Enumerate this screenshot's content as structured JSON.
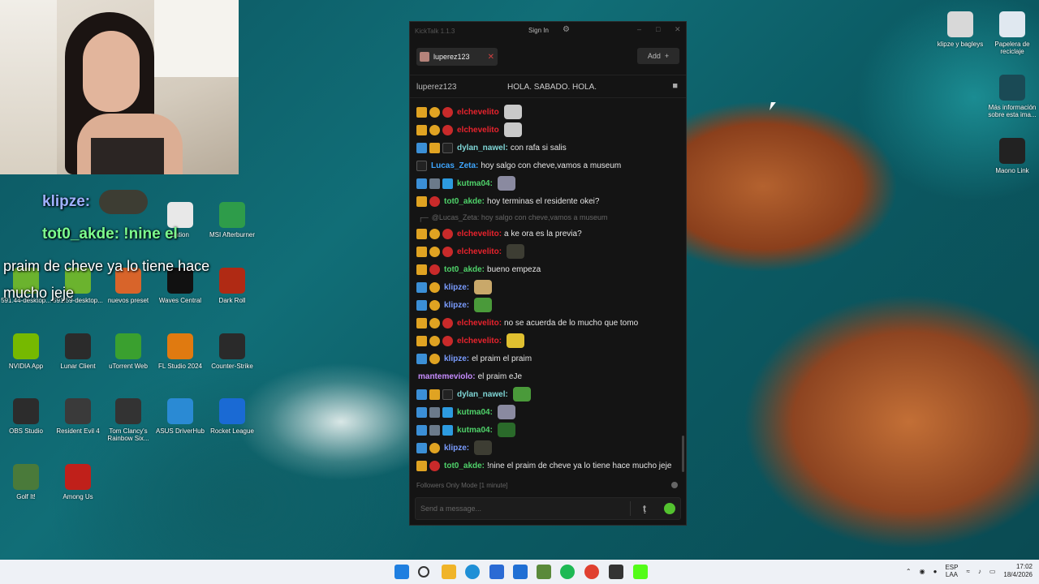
{
  "overlay": {
    "line1_user": "klipze:",
    "line2_user": "tot0_akde: !nine el",
    "message": "praim de cheve ya lo tiene hace mucho jeje"
  },
  "desktop_icons_left": [
    {
      "label": "dation",
      "color": "#e8e8e8"
    },
    {
      "label": "MSI Afterburner",
      "color": "#2e9c4a"
    },
    {
      "label": "591.44-desktop...",
      "color": "#6bb32e"
    },
    {
      "label": "591.59-desktop...",
      "color": "#6bb32e"
    },
    {
      "label": "nuevos preset",
      "color": "#d8642a"
    },
    {
      "label": "Waves Central",
      "color": "#111111"
    },
    {
      "label": "Dark Roll",
      "color": "#b02a14"
    },
    {
      "label": "NVIDIA App",
      "color": "#76b900"
    },
    {
      "label": "Lunar Client",
      "color": "#2b2b2b"
    },
    {
      "label": "uTorrent Web",
      "color": "#3aa02f"
    },
    {
      "label": "FL Studio 2024",
      "color": "#e07a10"
    },
    {
      "label": "Counter-Strike",
      "color": "#2a2a2a"
    },
    {
      "label": "OBS Studio",
      "color": "#2c2c2c"
    },
    {
      "label": "Resident Evil 4",
      "color": "#3a3a3a"
    },
    {
      "label": "Tom Clancy's Rainbow Six...",
      "color": "#333333"
    },
    {
      "label": "ASUS DriverHub",
      "color": "#2a8ad4"
    },
    {
      "label": "Rocket League",
      "color": "#1a6ad4"
    },
    {
      "label": "Golf It!",
      "color": "#4a7a3a"
    },
    {
      "label": "Among Us",
      "color": "#c0201a"
    }
  ],
  "desktop_icons_right": [
    {
      "label": "klipze y bagleys",
      "color": "#d8d8d8"
    },
    {
      "label": "Papelera de reciclaje",
      "color": "#e0e8f0"
    },
    {
      "label": "Más información sobre esta ima...",
      "color": "#1a4a55"
    },
    {
      "label": "Maono Link",
      "color": "#222222"
    }
  ],
  "kicktalk": {
    "title": "KickTalk 1.1.3",
    "sign_in": "Sign In",
    "tab_label": "luperez123",
    "add_label": "Add",
    "channel": "luperez123",
    "pinned": "HOLA. SABADO. HOLA.",
    "mode_text": "Followers Only Mode [1 minute]",
    "input_placeholder": "Send a message...",
    "messages": [
      {
        "badges": [
          "crown",
          "one",
          "red"
        ],
        "user": "elchevelito",
        "user_color": "#e8232d",
        "text": "",
        "emote": "#c9c9c9"
      },
      {
        "badges": [
          "crown",
          "one",
          "red"
        ],
        "user": "elchevelito",
        "user_color": "#e8232d",
        "text": "",
        "emote": "#c9c9c9"
      },
      {
        "badges": [
          "blue",
          "crown",
          "glasses"
        ],
        "user": "dylan_nawel:",
        "user_color": "#7fd6d6",
        "text": "con rafa si salis",
        "emote": ""
      },
      {
        "badges": [
          "glasses"
        ],
        "user": "Lucas_Zeta:",
        "user_color": "#3ea6ff",
        "text": "hoy salgo con cheve,vamos a museum",
        "emote": ""
      },
      {
        "badges": [
          "blue",
          "grey",
          "cube"
        ],
        "user": "kutma04:",
        "user_color": "#4fd36a",
        "text": "",
        "emote": "#8a8aa0"
      },
      {
        "badges": [
          "crown",
          "red"
        ],
        "user": "tot0_akde:",
        "user_color": "#4fd36a",
        "text": "hoy terminas el residente okei?",
        "emote": ""
      },
      {
        "reply": "@Lucas_Zeta: hoy salgo con cheve,vamos a museum"
      },
      {
        "badges": [
          "crown",
          "one",
          "red"
        ],
        "user": "elchevelito:",
        "user_color": "#e8232d",
        "text": "a ke ora es la previa?",
        "emote": ""
      },
      {
        "badges": [
          "crown",
          "one",
          "red"
        ],
        "user": "elchevelito:",
        "user_color": "#e8232d",
        "text": "",
        "emote": "#3d3d33"
      },
      {
        "badges": [
          "crown",
          "red"
        ],
        "user": "tot0_akde:",
        "user_color": "#4fd36a",
        "text": "bueno empeza",
        "emote": ""
      },
      {
        "badges": [
          "blue",
          "one"
        ],
        "user": "klipze:",
        "user_color": "#7a9cff",
        "text": "",
        "emote": "#c9a86a"
      },
      {
        "badges": [
          "blue",
          "one"
        ],
        "user": "klipze:",
        "user_color": "#7a9cff",
        "text": "",
        "emote": "#4a9a3a"
      },
      {
        "badges": [
          "crown",
          "one",
          "red"
        ],
        "user": "elchevelito:",
        "user_color": "#e8232d",
        "text": "no se acuerda de lo mucho que tomo",
        "emote": ""
      },
      {
        "badges": [
          "crown",
          "one",
          "red"
        ],
        "user": "elchevelito:",
        "user_color": "#e8232d",
        "text": "",
        "emote": "#e0c030"
      },
      {
        "badges": [
          "blue",
          "one"
        ],
        "user": "klipze:",
        "user_color": "#7a9cff",
        "text": "el praim el praim",
        "emote": ""
      },
      {
        "badges": [],
        "user": "mantemeviolo:",
        "user_color": "#c78cff",
        "text": "el praim eJe",
        "emote": ""
      },
      {
        "badges": [
          "blue",
          "crown",
          "glasses"
        ],
        "user": "dylan_nawel:",
        "user_color": "#7fd6d6",
        "text": "",
        "emote": "#4a9a3a"
      },
      {
        "badges": [
          "blue",
          "grey",
          "cube"
        ],
        "user": "kutma04:",
        "user_color": "#4fd36a",
        "text": "",
        "emote": "#8a8aa0"
      },
      {
        "badges": [
          "blue",
          "grey",
          "cube"
        ],
        "user": "kutma04:",
        "user_color": "#4fd36a",
        "text": "",
        "emote": "#2a6a2a"
      },
      {
        "badges": [
          "blue",
          "one"
        ],
        "user": "klipze:",
        "user_color": "#7a9cff",
        "text": "",
        "emote": "#3d3d33"
      },
      {
        "badges": [
          "crown",
          "red"
        ],
        "user": "tot0_akde:",
        "user_color": "#4fd36a",
        "text": "!nine el praim de cheve ya lo tiene hace mucho jeje",
        "emote": ""
      }
    ]
  },
  "taskbar": {
    "lang": "ESP",
    "lang2": "LAA",
    "time": "17:02",
    "date": "18/4/2026",
    "apps": [
      {
        "name": "start-icon",
        "color": "#1f7fe0"
      },
      {
        "name": "search-icon",
        "color": "#333333"
      },
      {
        "name": "file-explorer-icon",
        "color": "#f0b429"
      },
      {
        "name": "edge-icon",
        "color": "#1f8fd6"
      },
      {
        "name": "store-icon",
        "color": "#2a6ad4"
      },
      {
        "name": "outlook-icon",
        "color": "#1f6fd4"
      },
      {
        "name": "minecraft-icon",
        "color": "#5a8a3a"
      },
      {
        "name": "spotify-icon",
        "color": "#1db954"
      },
      {
        "name": "chrome-icon",
        "color": "#e04030"
      },
      {
        "name": "app-icon",
        "color": "#333333"
      },
      {
        "name": "kick-icon",
        "color": "#53fc18"
      }
    ]
  }
}
